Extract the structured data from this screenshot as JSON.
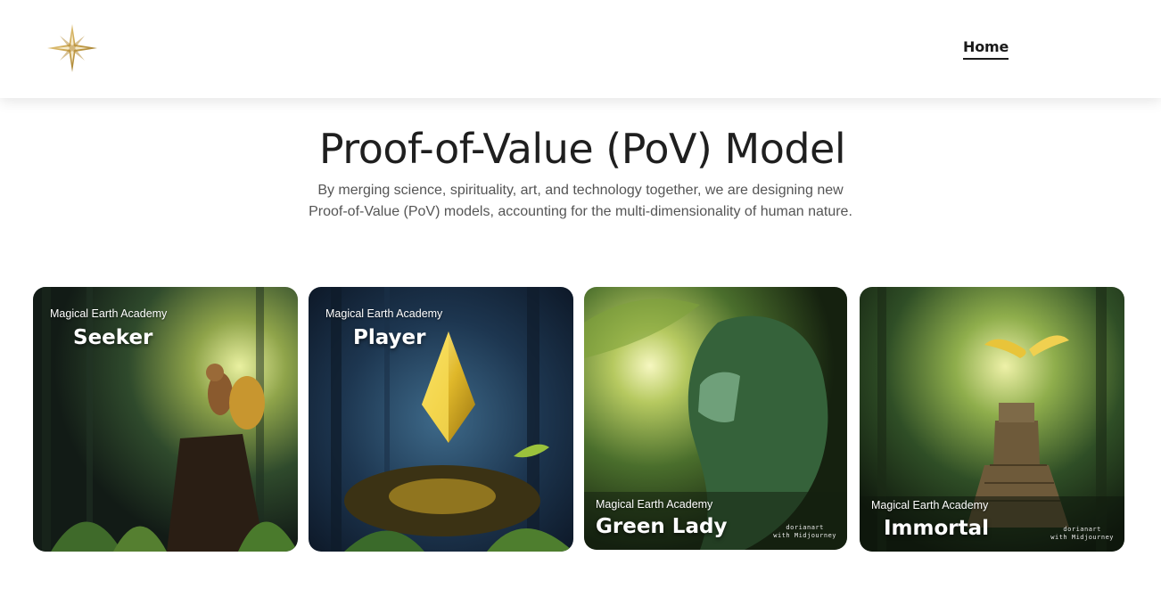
{
  "header": {
    "logo_icon": "four-point-star-icon",
    "nav": {
      "home_label": "Home"
    }
  },
  "hero": {
    "title": "Proof-of-Value (PoV) Model",
    "subtitle_line1": "By merging science, spirituality, art, and technology together, we are designing new",
    "subtitle_line2": "Proof-of-Value (PoV) models, accounting for the multi-dimensionality of human nature."
  },
  "cards": [
    {
      "academy": "Magical Earth Academy",
      "title": "Seeker",
      "image": "squirrel-in-forest"
    },
    {
      "academy": "Magical Earth Academy",
      "title": "Player",
      "image": "golden-crystal-in-forest"
    },
    {
      "academy": "Magical Earth Academy",
      "title": "Green Lady",
      "image": "green-lady-portrait",
      "credit_line1": "dorianart",
      "credit_line2": "with Midjourney"
    },
    {
      "academy": "Magical Earth Academy",
      "title": "Immortal",
      "image": "pyramid-and-bird",
      "credit_line1": "dorianart",
      "credit_line2": "with Midjourney"
    }
  ],
  "colors": {
    "accent_gold": "#c9a24a",
    "text_dark": "#1f1f1f",
    "text_muted": "#555555"
  }
}
